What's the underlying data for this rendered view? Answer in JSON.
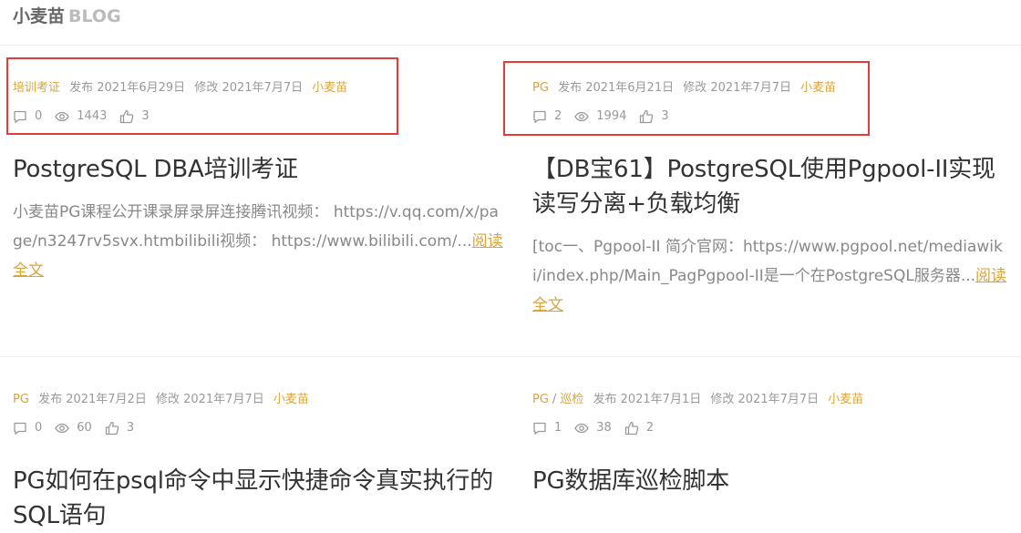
{
  "header": {
    "brand_name": "小麦苗",
    "brand_sub": "BLOG"
  },
  "posts": [
    {
      "categories": [
        "培训考证"
      ],
      "published": "发布 2021年6月29日",
      "modified": "修改 2021年7月7日",
      "author": "小麦苗",
      "comments": "0",
      "views": "1443",
      "likes": "3",
      "title": "PostgreSQL DBA培训考证",
      "excerpt": "小麦苗PG课程公开课录屏录屏连接腾讯视频： https://v.qq.com/x/page/n3247rv5svx.htmbilibili视频： https://www.bilibili.com/...",
      "read_more": "阅读全文"
    },
    {
      "categories": [
        "PG"
      ],
      "published": "发布 2021年6月21日",
      "modified": "修改 2021年7月7日",
      "author": "小麦苗",
      "comments": "2",
      "views": "1994",
      "likes": "3",
      "title": "【DB宝61】PostgreSQL使用Pgpool-II实现读写分离+负载均衡",
      "excerpt": "[toc一、Pgpool-II 简介官网：https://www.pgpool.net/mediawiki/index.php/Main_PagPgpool-II是一个在PostgreSQL服务器...",
      "read_more": "阅读全文"
    },
    {
      "categories": [
        "PG"
      ],
      "published": "发布 2021年7月2日",
      "modified": "修改 2021年7月7日",
      "author": "小麦苗",
      "comments": "0",
      "views": "60",
      "likes": "3",
      "title": "PG如何在psql命令中显示快捷命令真实执行的SQL语句",
      "excerpt": "",
      "read_more": ""
    },
    {
      "categories": [
        "PG",
        "巡检"
      ],
      "category_separator": "/",
      "published": "发布 2021年7月1日",
      "modified": "修改 2021年7月7日",
      "author": "小麦苗",
      "comments": "1",
      "views": "38",
      "likes": "2",
      "title": "PG数据库巡检脚本",
      "excerpt": "",
      "read_more": ""
    }
  ],
  "colors": {
    "accent": "#d9a43c",
    "highlight_box": "#e03c3c",
    "title": "#333333",
    "muted": "#999999"
  },
  "icons": {
    "comment": "comment-icon",
    "views": "eye-icon",
    "likes": "thumbs-up-icon"
  }
}
